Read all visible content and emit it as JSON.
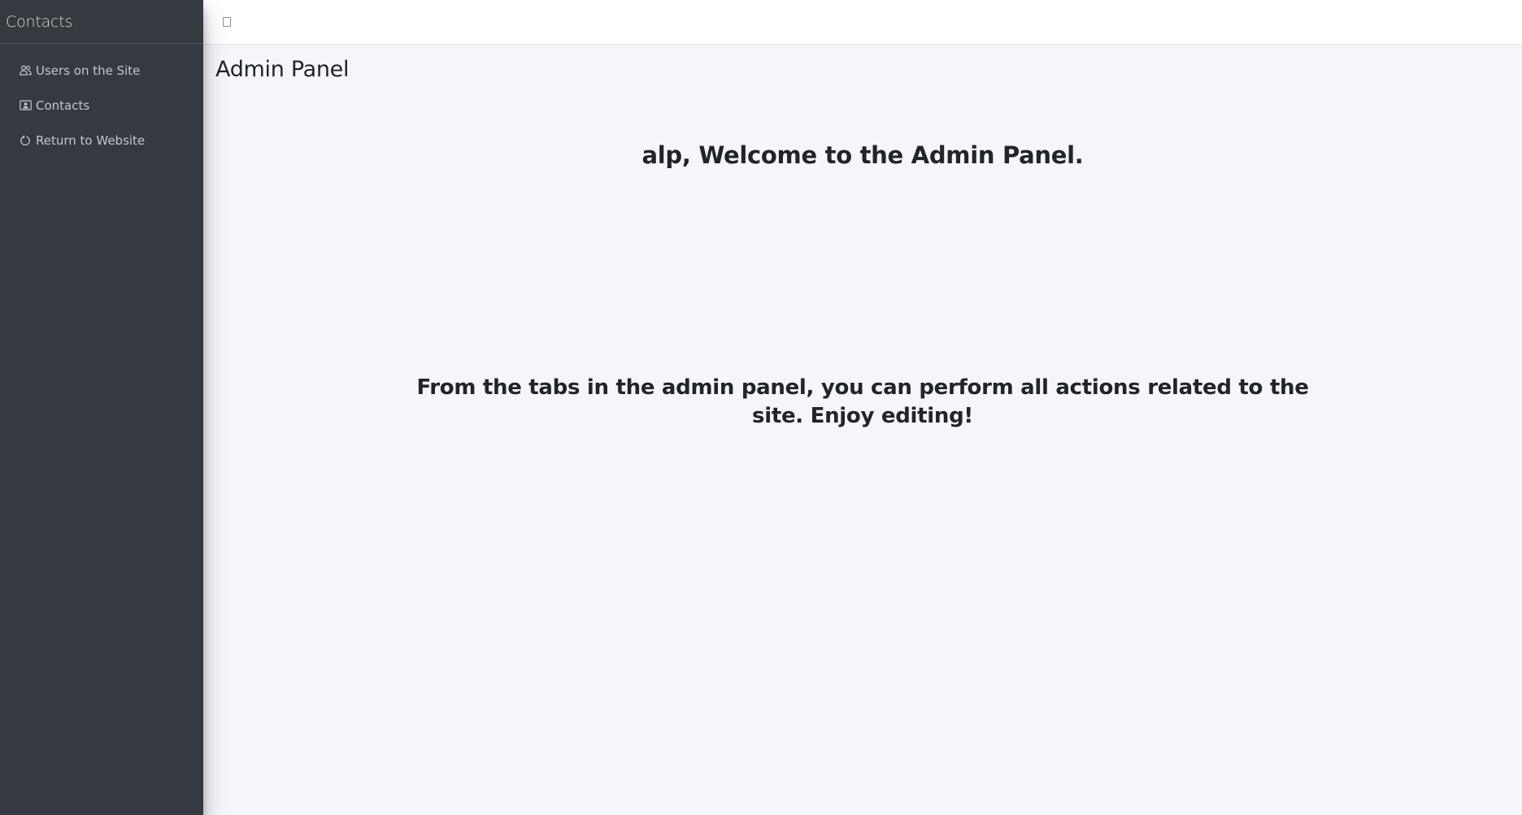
{
  "sidebar": {
    "brand": "Contacts",
    "items": [
      {
        "label": "Users on the Site",
        "icon": "users-icon"
      },
      {
        "label": "Contacts",
        "icon": "contact-card-icon"
      },
      {
        "label": "Return to Website",
        "icon": "refresh-icon"
      }
    ]
  },
  "topbar": {
    "toggle_icon": "menu-toggle-icon"
  },
  "main": {
    "title": "Admin Panel",
    "welcome": "alp, Welcome to the Admin Panel.",
    "info": "From the tabs in the admin panel, you can perform all actions related to the site. Enjoy editing!"
  },
  "colors": {
    "sidebar_bg": "#343a40",
    "sidebar_text": "#c2c7d0",
    "content_bg": "#f4f6f9",
    "topbar_bg": "#ffffff"
  }
}
